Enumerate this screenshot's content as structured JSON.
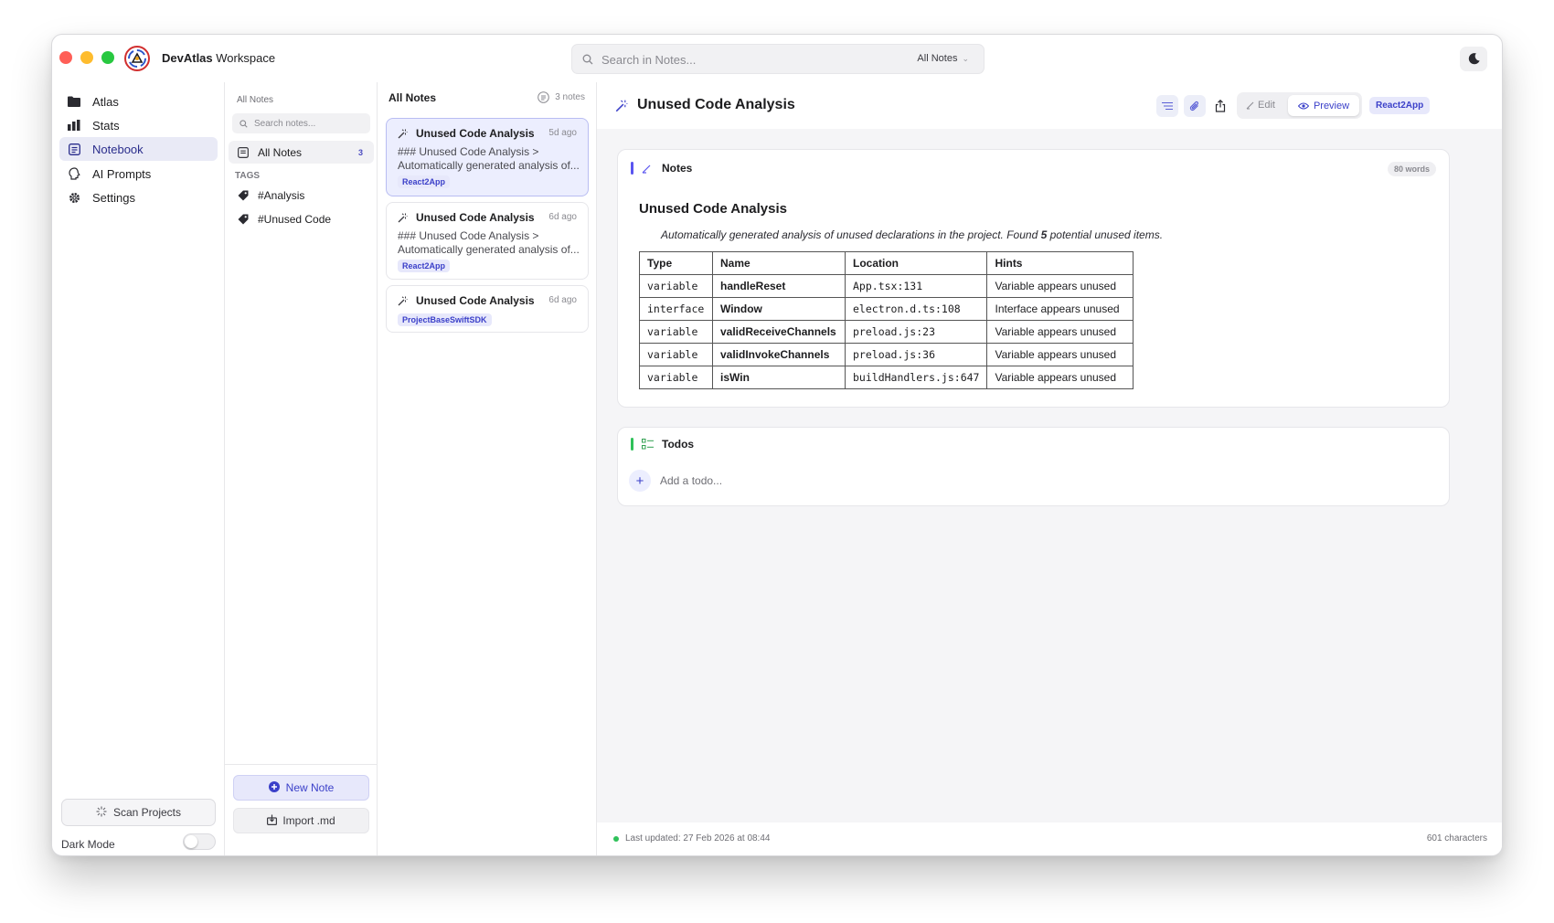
{
  "colors": {
    "accent": "#3b40c9",
    "accent_bg": "#e7e8fb",
    "notes_bar": "#5a55f0",
    "todos_bar": "#30c15a",
    "status_ok": "#30c15a"
  },
  "app": {
    "name": "DevAtlas",
    "suffix": "Workspace"
  },
  "search": {
    "placeholder": "Search in Notes...",
    "scope": "All Notes"
  },
  "sidebar": {
    "items": [
      {
        "label": "Atlas",
        "icon": "folder-icon"
      },
      {
        "label": "Stats",
        "icon": "bar-chart-icon"
      },
      {
        "label": "Notebook",
        "icon": "notebook-icon",
        "active": true
      },
      {
        "label": "AI Prompts",
        "icon": "brain-icon"
      },
      {
        "label": "Settings",
        "icon": "gear-icon"
      }
    ],
    "scan_label": "Scan Projects",
    "dark_mode_label": "Dark Mode",
    "dark_mode_on": false
  },
  "tags_panel": {
    "header": "All Notes",
    "search_placeholder": "Search notes...",
    "all_notes_label": "All Notes",
    "all_notes_count": "3",
    "tags_header": "TAGS",
    "tags": [
      "#Analysis",
      "#Unused Code"
    ],
    "new_note_label": "New Note",
    "import_label": "Import .md"
  },
  "notes_list": {
    "title": "All Notes",
    "count": "3 notes",
    "notes": [
      {
        "title": "Unused Code Analysis",
        "time": "5d ago",
        "snippet": "### Unused Code Analysis  >  Automatically generated analysis of...",
        "tag": "React2App",
        "active": true
      },
      {
        "title": "Unused Code Analysis",
        "time": "6d ago",
        "snippet": "### Unused Code Analysis  >  Automatically generated analysis of...",
        "tag": "React2App"
      },
      {
        "title": "Unused Code Analysis",
        "time": "6d ago",
        "snippet": "",
        "tag": "ProjectBaseSwiftSDK"
      }
    ]
  },
  "detail": {
    "title": "Unused Code Analysis",
    "edit_label": "Edit",
    "preview_label": "Preview",
    "project_badge": "React2App",
    "notes_section": {
      "label": "Notes",
      "word_count": "80 words",
      "heading": "Unused Code Analysis",
      "quote_before": "Automatically generated analysis of unused declarations in the project. Found ",
      "quote_count": "5",
      "quote_after": " potential unused items.",
      "table": {
        "headers": [
          "Type",
          "Name",
          "Location",
          "Hints"
        ],
        "rows": [
          [
            "variable",
            "handleReset",
            "App.tsx:131",
            "Variable appears unused"
          ],
          [
            "interface",
            "Window",
            "electron.d.ts:108",
            "Interface appears unused"
          ],
          [
            "variable",
            "validReceiveChannels",
            "preload.js:23",
            "Variable appears unused"
          ],
          [
            "variable",
            "validInvokeChannels",
            "preload.js:36",
            "Variable appears unused"
          ],
          [
            "variable",
            "isWin",
            "buildHandlers.js:647",
            "Variable appears unused"
          ]
        ]
      }
    },
    "todos_section": {
      "label": "Todos",
      "add_placeholder": "Add a todo..."
    },
    "status": {
      "last_updated": "Last updated: 27 Feb 2026 at 08:44",
      "characters": "601 characters"
    }
  }
}
